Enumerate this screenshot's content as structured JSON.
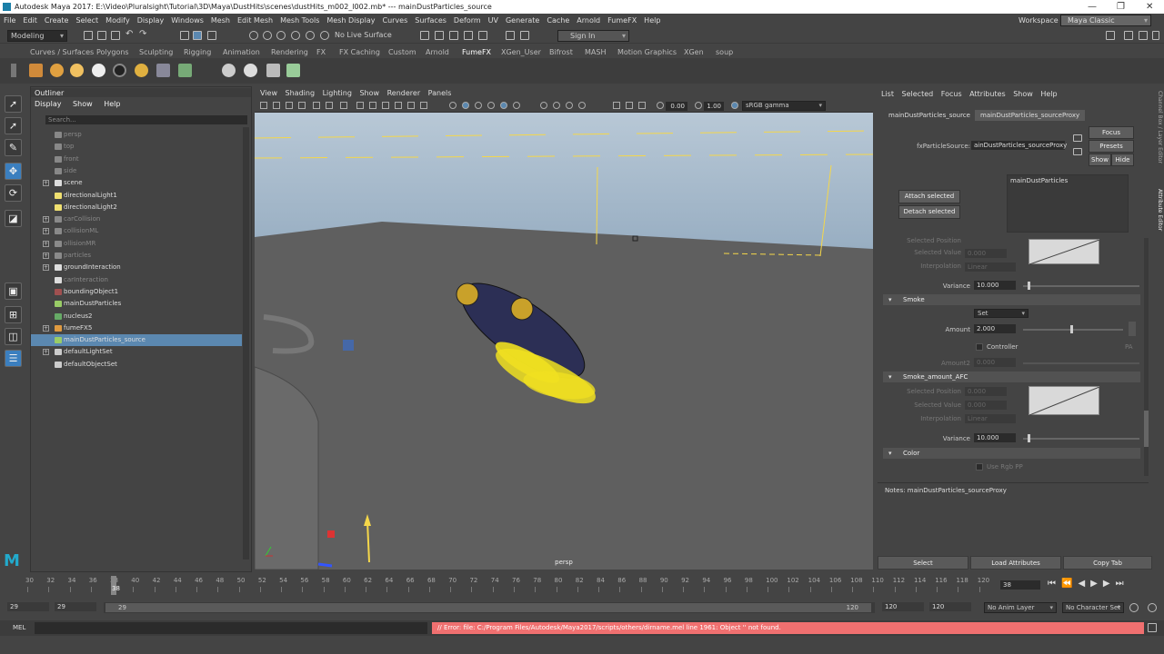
{
  "window": {
    "title": "Autodesk Maya 2017: E:\\Video\\Pluralsight\\Tutorial\\3D\\Maya\\DustHits\\scenes\\dustHits_m002_l002.mb*   ---   mainDustParticles_source",
    "controls": [
      "—",
      "❐",
      "✕"
    ]
  },
  "menubar": [
    "File",
    "Edit",
    "Create",
    "Select",
    "Modify",
    "Display",
    "Windows",
    "Mesh",
    "Edit Mesh",
    "Mesh Tools",
    "Mesh Display",
    "Curves",
    "Surfaces",
    "Deform",
    "UV",
    "Generate",
    "Cache",
    "Arnold",
    "FumeFX",
    "Help"
  ],
  "workspace": {
    "label": "Workspace :",
    "value": "Maya Classic"
  },
  "statusline": {
    "mode": "Modeling",
    "live_surface": "No Live Surface",
    "sign_in": "Sign In"
  },
  "shelf_tabs": [
    "Curves / Surfaces",
    "Polygons",
    "Sculpting",
    "Rigging",
    "Animation",
    "Rendering",
    "FX",
    "FX Caching",
    "Custom",
    "Arnold",
    "FumeFX",
    "XGen_User",
    "Bifrost",
    "MASH",
    "Motion Graphics",
    "XGen",
    "soup"
  ],
  "shelf_active": "FumeFX",
  "outliner": {
    "title": "Outliner",
    "menu": [
      "Display",
      "Show",
      "Help"
    ],
    "search_placeholder": "Search...",
    "items": [
      {
        "label": "persp",
        "dim": true,
        "expand": false,
        "icon": "camera-icon"
      },
      {
        "label": "top",
        "dim": true,
        "expand": false,
        "icon": "camera-icon"
      },
      {
        "label": "front",
        "dim": true,
        "expand": false,
        "icon": "camera-icon"
      },
      {
        "label": "side",
        "dim": true,
        "expand": false,
        "icon": "camera-icon"
      },
      {
        "label": "scene",
        "dim": false,
        "expand": true,
        "icon": "transform-icon"
      },
      {
        "label": "directionalLight1",
        "dim": false,
        "expand": false,
        "icon": "light-icon"
      },
      {
        "label": "directionalLight2",
        "dim": false,
        "expand": false,
        "icon": "light-icon"
      },
      {
        "label": "carCollision",
        "dim": true,
        "expand": true,
        "icon": "mesh-icon"
      },
      {
        "label": "collisionML",
        "dim": true,
        "expand": true,
        "icon": "mesh-icon"
      },
      {
        "label": "ollisionMR",
        "dim": true,
        "expand": true,
        "icon": "mesh-icon"
      },
      {
        "label": "particles",
        "dim": true,
        "expand": true,
        "icon": "mesh-icon"
      },
      {
        "label": "groundInteraction",
        "dim": false,
        "expand": true,
        "icon": "transform-icon"
      },
      {
        "label": "carInteraction",
        "dim": true,
        "expand": false,
        "icon": "transform-icon"
      },
      {
        "label": "boundingObject1",
        "dim": false,
        "expand": false,
        "icon": "bbox-icon"
      },
      {
        "label": "mainDustParticles",
        "dim": false,
        "expand": false,
        "icon": "particle-icon"
      },
      {
        "label": "nucleus2",
        "dim": false,
        "expand": false,
        "icon": "nucleus-icon"
      },
      {
        "label": "fumeFX5",
        "dim": false,
        "expand": true,
        "icon": "fumefx-icon"
      },
      {
        "label": "mainDustParticles_source",
        "dim": false,
        "expand": false,
        "icon": "emitter-icon",
        "selected": true
      },
      {
        "label": "defaultLightSet",
        "dim": false,
        "expand": true,
        "icon": "set-icon"
      },
      {
        "label": "defaultObjectSet",
        "dim": false,
        "expand": false,
        "icon": "set-icon"
      }
    ]
  },
  "viewport": {
    "menu": [
      "View",
      "Shading",
      "Lighting",
      "Show",
      "Renderer",
      "Panels"
    ],
    "exposure": "0.00",
    "gamma": "1.00",
    "color_space": "sRGB gamma",
    "camera_label": "persp"
  },
  "attribute_editor": {
    "menu": [
      "List",
      "Selected",
      "Focus",
      "Attributes",
      "Show",
      "Help"
    ],
    "tabs": [
      "mainDustParticles_source",
      "mainDustParticles_sourceProxy"
    ],
    "active_tab": "mainDustParticles_sourceProxy",
    "fx_source_label": "fxParticleSource:",
    "fx_source_value": "ainDustParticles_sourceProxy",
    "focus_btn": "Focus",
    "presets_btn": "Presets",
    "show_btn": "Show",
    "hide_btn": "Hide",
    "attach_btn": "Attach selected",
    "detach_btn": "Detach selected",
    "particle_list": [
      "mainDustParticles"
    ],
    "ramp1": {
      "selected_position_label": "Selected Position",
      "selected_value_label": "Selected Value",
      "selected_value": "0.000",
      "interpolation_label": "Interpolation",
      "interpolation": "Linear",
      "variance_label": "Variance",
      "variance": "10.000"
    },
    "smoke_section": "Smoke",
    "smoke_mode": "Set",
    "amount_label": "Amount",
    "amount": "2.000",
    "controller_label": "Controller",
    "pa_label": "PA",
    "amount2_label": "Amount2",
    "amount2": "0.000",
    "smoke_afc_section": "Smoke_amount_AFC",
    "ramp2": {
      "selected_position_label": "Selected Position",
      "selected_position": "0.000",
      "selected_value_label": "Selected Value",
      "selected_value": "0.000",
      "interpolation_label": "Interpolation",
      "interpolation": "Linear",
      "variance_label": "Variance",
      "variance": "10.000"
    },
    "color_section": "Color",
    "use_rgb_pp": "Use Rgb PP",
    "notes": "Notes:  mainDustParticles_sourceProxy",
    "buttons": [
      "Select",
      "Load Attributes",
      "Copy Tab"
    ],
    "side_tabs": [
      "Channel Box / Layer Editor",
      "Attribute Editor"
    ]
  },
  "timeslider": {
    "ticks": [
      "30",
      "32",
      "34",
      "36",
      "38",
      "40",
      "42",
      "44",
      "46",
      "48",
      "50",
      "52",
      "54",
      "56",
      "58",
      "60",
      "62",
      "64",
      "66",
      "68",
      "70",
      "72",
      "74",
      "76",
      "78",
      "80",
      "82",
      "84",
      "86",
      "88",
      "90",
      "92",
      "94",
      "96",
      "98",
      "100",
      "102",
      "104",
      "106",
      "108",
      "110",
      "112",
      "114",
      "116",
      "118",
      "120"
    ],
    "current_frame": "38",
    "current_marker": "38"
  },
  "rangebar": {
    "start": "29",
    "playback_start": "29",
    "range_start_label": "29",
    "range_end_label": "120",
    "playback_end": "120",
    "end": "120",
    "anim_layer": "No Anim Layer",
    "char_set": "No Character Set"
  },
  "command_line": {
    "label": "MEL",
    "error": "// Error: file: C:/Program Files/Autodesk/Maya2017/scripts/others/dirname.mel line 1961: Object '' not found."
  }
}
